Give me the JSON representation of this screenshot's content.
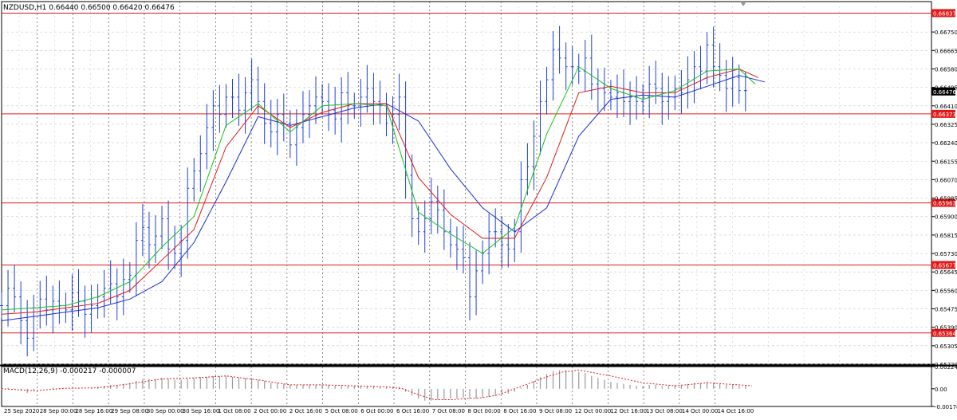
{
  "title": "NZDUSD,H1  0.66440 0.66500 0.66420 0.66476",
  "macd_label": "MACD(12,26,9) -0.000217 -0.000007",
  "colors": {
    "price": "#1f3fd8",
    "ma_fast": "#18c418",
    "ma_mid": "#e01a1a",
    "ma_slow": "#1a2fd0",
    "level_line": "#e01a1a",
    "level_box": "#e01a1a",
    "current_box": "#000000",
    "grid": "#c9c9c9",
    "vgrid": "#555555",
    "histogram": "#9a9a9a",
    "signal": "#e01a1a"
  },
  "chart_data": {
    "type": "line",
    "symbol": "NZDUSD",
    "timeframe": "H1",
    "ohlc_header": {
      "open": 0.6644,
      "high": 0.665,
      "low": 0.6642,
      "close": 0.66476
    },
    "y_range": [
      0.6522,
      0.6689
    ],
    "y_ticks": [
      "0.66750",
      "0.66665",
      "0.66580",
      "0.66495",
      "0.66410",
      "0.66325",
      "0.66240",
      "0.66155",
      "0.66070",
      "0.65985",
      "0.65900",
      "0.65815",
      "0.65730",
      "0.65645",
      "0.65560",
      "0.65475",
      "0.65390",
      "0.65305",
      "0.65220"
    ],
    "levels": [
      "0.66837",
      "0.66373",
      "0.65963",
      "0.65677",
      "0.65364"
    ],
    "current_price": "0.66476",
    "x_labels": [
      "25 Sep 2020",
      "28 Sep 00:00",
      "28 Sep 16:00",
      "29 Sep 08:00",
      "30 Sep 00:00",
      "30 Sep 16:00",
      "1 Oct 08:00",
      "2 Oct 00:00",
      "2 Oct 16:00",
      "5 Oct 08:00",
      "6 Oct 00:00",
      "6 Oct 16:00",
      "7 Oct 08:00",
      "8 Oct 00:00",
      "8 Oct 16:00",
      "9 Oct 08:00",
      "12 Oct 00:00",
      "12 Oct 16:00",
      "13 Oct 08:00",
      "14 Oct 00:00",
      "14 Oct 16:00"
    ],
    "price_series": {
      "name": "NZDUSD",
      "x": [
        0,
        8,
        16,
        24,
        32,
        40,
        48,
        56,
        64,
        72,
        80,
        88,
        96,
        104,
        112,
        120,
        128,
        136,
        144,
        152,
        160,
        168,
        176,
        184,
        192,
        200,
        208,
        216,
        224,
        232,
        240,
        248,
        256,
        264,
        272,
        280,
        288,
        296,
        304,
        312,
        320,
        328,
        336,
        344,
        352,
        360,
        368,
        376,
        384,
        392,
        400,
        408,
        416,
        424,
        432,
        440,
        448,
        456,
        464,
        472,
        480,
        488,
        496,
        504,
        512,
        520,
        528,
        536,
        544,
        552,
        560,
        568,
        576,
        584,
        592,
        600,
        608,
        616,
        624,
        632,
        640,
        648,
        656,
        664,
        672,
        680,
        688,
        696,
        704,
        712,
        720,
        728,
        736,
        744,
        752,
        760,
        768,
        776,
        784,
        792,
        800,
        808,
        816,
        824,
        832,
        840,
        848,
        856,
        864,
        872,
        880,
        888,
        896,
        904,
        912,
        920,
        928
      ],
      "values": [
        0.6549,
        0.6557,
        0.6553,
        0.6542,
        0.6534,
        0.6548,
        0.6552,
        0.6547,
        0.6551,
        0.6549,
        0.6547,
        0.6555,
        0.6551,
        0.6545,
        0.6549,
        0.6553,
        0.6557,
        0.6559,
        0.6553,
        0.6561,
        0.6563,
        0.6579,
        0.6585,
        0.6577,
        0.6581,
        0.6589,
        0.6575,
        0.6573,
        0.6579,
        0.6603,
        0.6611,
        0.6619,
        0.6631,
        0.6641,
        0.6637,
        0.6645,
        0.6645,
        0.6639,
        0.6647,
        0.6653,
        0.6643,
        0.6633,
        0.6629,
        0.6637,
        0.6633,
        0.6623,
        0.6631,
        0.6637,
        0.6641,
        0.6645,
        0.6643,
        0.6639,
        0.6635,
        0.6647,
        0.6641,
        0.6641,
        0.6645,
        0.6649,
        0.6643,
        0.6641,
        0.6633,
        0.6637,
        0.6645,
        0.6609,
        0.6589,
        0.6583,
        0.6589,
        0.6597,
        0.6593,
        0.6583,
        0.6577,
        0.6575,
        0.6571,
        0.6553,
        0.6565,
        0.6573,
        0.6583,
        0.6583,
        0.6577,
        0.6575,
        0.6583,
        0.6607,
        0.6613,
        0.6627,
        0.6643,
        0.6653,
        0.6667,
        0.6663,
        0.6659,
        0.6659,
        0.6657,
        0.6663,
        0.6651,
        0.6649,
        0.6647,
        0.6645,
        0.6647,
        0.6643,
        0.6645,
        0.6643,
        0.6645,
        0.6651,
        0.6649,
        0.6643,
        0.6645,
        0.6649,
        0.6647,
        0.6653,
        0.6659,
        0.6657,
        0.6669,
        0.6659,
        0.6655,
        0.6649,
        0.6654,
        0.6648,
        0.6648
      ]
    },
    "ma_fast": {
      "x": [
        0,
        40,
        80,
        120,
        160,
        200,
        240,
        280,
        320,
        360,
        400,
        440,
        480,
        520,
        560,
        600,
        640,
        680,
        720,
        760,
        800,
        840,
        880,
        920,
        940
      ],
      "values": [
        0.6547,
        0.6548,
        0.6549,
        0.6553,
        0.656,
        0.6576,
        0.659,
        0.6632,
        0.6642,
        0.6629,
        0.6641,
        0.6642,
        0.6641,
        0.6592,
        0.6582,
        0.6573,
        0.6585,
        0.6628,
        0.6659,
        0.6649,
        0.6644,
        0.6648,
        0.6657,
        0.6658,
        0.6651
      ]
    },
    "ma_mid": {
      "x": [
        0,
        40,
        80,
        120,
        160,
        200,
        240,
        280,
        320,
        360,
        400,
        440,
        480,
        520,
        560,
        600,
        640,
        680,
        720,
        760,
        800,
        840,
        880,
        920,
        944
      ],
      "values": [
        0.6545,
        0.6546,
        0.6548,
        0.655,
        0.6556,
        0.657,
        0.6584,
        0.6622,
        0.6641,
        0.6631,
        0.6638,
        0.6642,
        0.6642,
        0.6608,
        0.6591,
        0.658,
        0.658,
        0.6608,
        0.6647,
        0.665,
        0.6647,
        0.6647,
        0.6654,
        0.6658,
        0.6654
      ]
    },
    "ma_slow": {
      "x": [
        0,
        40,
        80,
        120,
        160,
        200,
        240,
        280,
        320,
        360,
        400,
        440,
        480,
        520,
        560,
        600,
        640,
        680,
        720,
        760,
        800,
        840,
        880,
        920,
        952
      ],
      "values": [
        0.6542,
        0.6544,
        0.6546,
        0.6548,
        0.6552,
        0.656,
        0.6578,
        0.6606,
        0.6636,
        0.6632,
        0.6636,
        0.664,
        0.6642,
        0.6634,
        0.6612,
        0.6594,
        0.6583,
        0.6594,
        0.6627,
        0.6644,
        0.6646,
        0.6645,
        0.665,
        0.6655,
        0.6652
      ]
    },
    "macd": {
      "y_ticks": [
        "0.002247",
        "0.00",
        "-0.001789"
      ],
      "y_range": [
        -0.001789,
        0.002247
      ],
      "histogram_x": [
        0,
        8,
        16,
        24,
        32,
        40,
        48,
        56,
        64,
        72,
        80,
        88,
        96,
        104,
        112,
        120,
        128,
        136,
        144,
        152,
        160,
        168,
        176,
        184,
        192,
        200,
        208,
        216,
        224,
        232,
        240,
        248,
        256,
        264,
        272,
        280,
        288,
        296,
        304,
        312,
        320,
        328,
        336,
        344,
        352,
        360,
        368,
        376,
        384,
        392,
        400,
        408,
        416,
        424,
        432,
        440,
        448,
        456,
        464,
        472,
        480,
        488,
        496,
        504,
        512,
        520,
        528,
        536,
        544,
        552,
        560,
        568,
        576,
        584,
        592,
        600,
        608,
        616,
        624,
        632,
        640,
        648,
        656,
        664,
        672,
        680,
        688,
        696,
        704,
        712,
        720,
        728,
        736,
        744,
        752,
        760,
        768,
        776,
        784,
        792,
        800,
        808,
        816,
        824,
        832,
        840,
        848,
        856,
        864,
        872,
        880,
        888,
        896,
        904,
        912,
        920,
        928
      ],
      "histogram": [
        -0.0001,
        0.0001,
        5e-05,
        -0.0002,
        -0.0004,
        -0.0002,
        0,
        0,
        0.0001,
        5e-05,
        0,
        0.0001,
        0.0001,
        0,
        0.0001,
        0.0002,
        0.0003,
        0.0004,
        0.0004,
        0.0005,
        0.0006,
        0.0008,
        0.001,
        0.001,
        0.001,
        0.0011,
        0.001,
        0.0009,
        0.0009,
        0.001,
        0.0011,
        0.0012,
        0.0012,
        0.0013,
        0.0013,
        0.0013,
        0.0012,
        0.0011,
        0.0011,
        0.0011,
        0.0009,
        0.0008,
        0.0006,
        0.0006,
        0.0005,
        0.0004,
        0.0004,
        0.0004,
        0.0004,
        0.0004,
        0.0004,
        0.0004,
        0.0003,
        0.0003,
        0.0003,
        0.0003,
        0.0003,
        0.0003,
        0.0003,
        0.0002,
        0.0002,
        0.0002,
        0.0002,
        -0.0003,
        -0.0007,
        -0.001,
        -0.0012,
        -0.0012,
        -0.0011,
        -0.0011,
        -0.001,
        -0.001,
        -0.0009,
        -0.001,
        -0.001,
        -0.0009,
        -0.0008,
        -0.0007,
        -0.0006,
        -0.0005,
        -0.0003,
        0.0001,
        0.0004,
        0.0008,
        0.0012,
        0.0015,
        0.0018,
        0.0019,
        0.0019,
        0.0018,
        0.0017,
        0.0016,
        0.0013,
        0.0011,
        0.0009,
        0.0007,
        0.0006,
        0.0005,
        0.0004,
        0.0003,
        0.0003,
        0.0004,
        0.0004,
        0.0003,
        0.0003,
        0.0004,
        0.0004,
        0.0005,
        0.0006,
        0.0006,
        0.0007,
        0.0006,
        0.0005,
        0.0004,
        0.0004,
        0.0003,
        0.0003
      ],
      "signal_x": [
        0,
        40,
        80,
        120,
        160,
        200,
        240,
        280,
        320,
        360,
        400,
        440,
        480,
        500,
        520,
        540,
        560,
        580,
        600,
        620,
        640,
        680,
        700,
        720,
        760,
        800,
        840,
        880,
        920,
        936
      ],
      "signal": [
        0,
        -0.0002,
        5e-05,
        0.0001,
        0.0005,
        0.001,
        0.0011,
        0.0013,
        0.0009,
        0.0004,
        0.0004,
        0.0003,
        0.0002,
        0,
        -0.0006,
        -0.0011,
        -0.0011,
        -0.001,
        -0.0009,
        -0.0006,
        0,
        0.0012,
        0.0017,
        0.0019,
        0.0013,
        0.0006,
        0.0003,
        0.0006,
        0.0004,
        0.0003
      ]
    }
  }
}
